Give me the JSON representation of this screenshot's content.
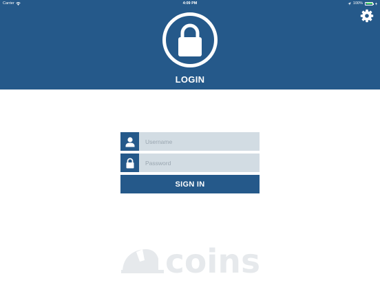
{
  "status_bar": {
    "carrier": "Carrier",
    "time": "4:09 PM",
    "battery": "100%",
    "battery_level": 1.0
  },
  "header": {
    "title": "LOGIN"
  },
  "form": {
    "username_placeholder": "Username",
    "password_placeholder": "Password",
    "submit_label": "SIGN IN"
  },
  "brand": {
    "logo_text": "coins"
  },
  "colors": {
    "primary": "#25598a",
    "field_bg": "#d2dce3",
    "logo": "#e6e9ec",
    "battery": "#4cd964"
  },
  "icons": [
    "wifi-icon",
    "location-arrow-icon",
    "battery-icon",
    "lock-icon",
    "gear-icon",
    "user-icon",
    "hard-hat-icon"
  ]
}
